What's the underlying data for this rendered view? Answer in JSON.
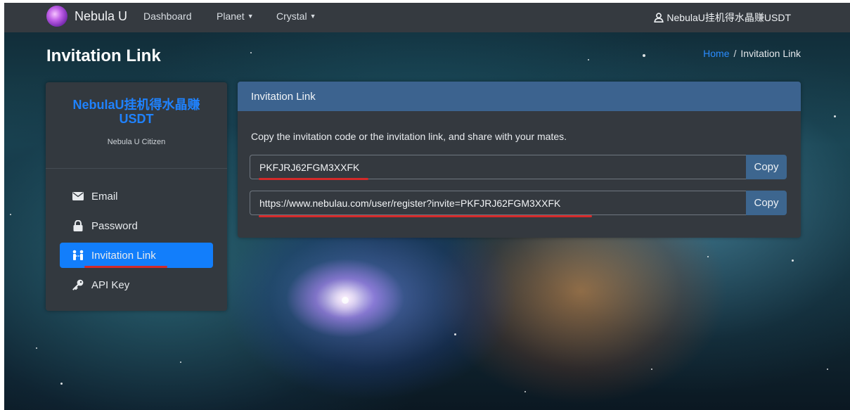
{
  "navbar": {
    "brand": "Nebula U",
    "links": [
      {
        "label": "Dashboard"
      },
      {
        "label": "Planet"
      },
      {
        "label": "Crystal"
      }
    ],
    "user": "NebulaU挂机得水晶赚USDT"
  },
  "page": {
    "title": "Invitation Link",
    "breadcrumb": {
      "home": "Home",
      "separator": "/",
      "current": "Invitation Link"
    }
  },
  "profile": {
    "name_line1": "NebulaU挂机得水晶赚",
    "name_line2": "USDT",
    "role": "Nebula U Citizen"
  },
  "menu": [
    {
      "label": "Email",
      "icon": "envelope-icon"
    },
    {
      "label": "Password",
      "icon": "lock-icon"
    },
    {
      "label": "Invitation Link",
      "icon": "invite-users-icon",
      "active": true
    },
    {
      "label": "API Key",
      "icon": "key-icon"
    }
  ],
  "card": {
    "header": "Invitation Link",
    "description": "Copy the invitation code or the invitation link, and share with your mates.",
    "code": "PKFJRJ62FGM3XXFK",
    "link": "https://www.nebulau.com/user/register?invite=PKFJRJ62FGM3XXFK",
    "copy_label": "Copy"
  },
  "colors": {
    "navbar": "#353a40",
    "accent": "#127efb",
    "card_header": "#3c638f",
    "annotation": "#d42a2a"
  }
}
